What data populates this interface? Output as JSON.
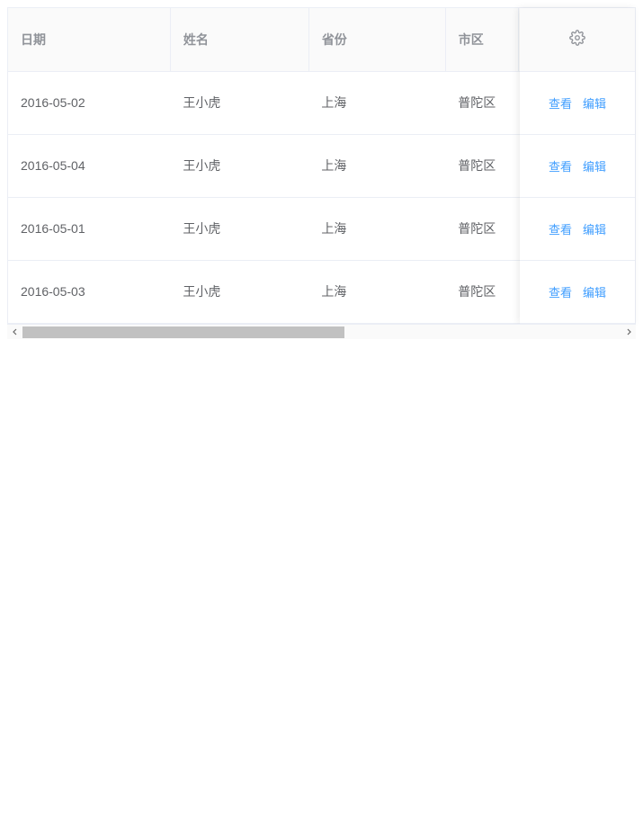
{
  "table": {
    "columns": {
      "date": "日期",
      "name": "姓名",
      "province": "省份",
      "city": "市区"
    },
    "actions": {
      "view": "查看",
      "edit": "编辑",
      "icon_name": "gear-icon"
    },
    "rows": [
      {
        "date": "2016-05-02",
        "name": "王小虎",
        "province": "上海",
        "city": "普陀区"
      },
      {
        "date": "2016-05-04",
        "name": "王小虎",
        "province": "上海",
        "city": "普陀区"
      },
      {
        "date": "2016-05-01",
        "name": "王小虎",
        "province": "上海",
        "city": "普陀区"
      },
      {
        "date": "2016-05-03",
        "name": "王小虎",
        "province": "上海",
        "city": "普陀区"
      }
    ]
  },
  "colors": {
    "link": "#409eff",
    "border": "#ebeef5",
    "header_bg": "#fafafa"
  }
}
